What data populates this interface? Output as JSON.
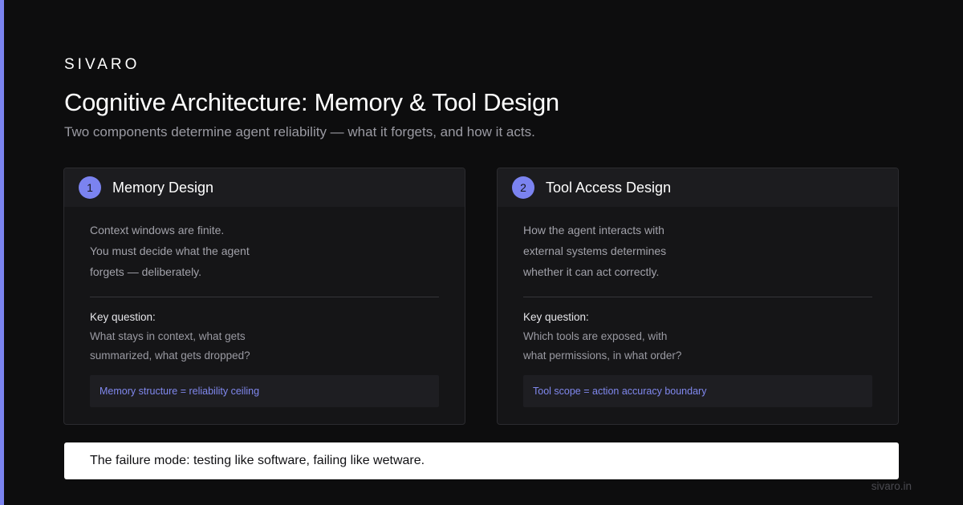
{
  "brand": "SIVARO",
  "title": "Cognitive Architecture: Memory & Tool Design",
  "subtitle": "Two components determine agent reliability — what it forgets, and how it acts.",
  "colors": {
    "accent": "#7b83f0",
    "background": "#0d0d0e",
    "card": "#151517"
  },
  "cards": [
    {
      "number": "1",
      "title": "Memory Design",
      "description": [
        "Context windows are finite.",
        "You must decide what the agent",
        "forgets — deliberately."
      ],
      "key_question_label": "Key question:",
      "key_question": [
        "What stays in context, what gets",
        "summarized, what gets dropped?"
      ],
      "callout": "Memory structure = reliability ceiling"
    },
    {
      "number": "2",
      "title": "Tool Access Design",
      "description": [
        "How the agent interacts with",
        "external systems determines",
        "whether it can act correctly."
      ],
      "key_question_label": "Key question:",
      "key_question": [
        "Which tools are exposed, with",
        "what permissions, in what order?"
      ],
      "callout": "Tool scope = action accuracy boundary"
    }
  ],
  "footer": "The failure mode: testing like software, failing like wetware.",
  "site": "sivaro.in"
}
